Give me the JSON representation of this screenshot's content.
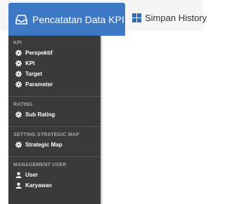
{
  "tabs": [
    {
      "label": "Pencatatan Data KPI",
      "icon": "inbox-tray-icon",
      "active": true
    },
    {
      "label": "Simpan History",
      "icon": "grid-icon",
      "active": false
    }
  ],
  "menu": {
    "sections": [
      {
        "header": "KPI",
        "items": [
          {
            "label": "Perspektif",
            "icon": "gear-icon"
          },
          {
            "label": "KPI",
            "icon": "gear-icon"
          },
          {
            "label": "Target",
            "icon": "gear-icon"
          },
          {
            "label": "Parameter",
            "icon": "gear-icon"
          }
        ]
      },
      {
        "header": "RATING",
        "items": [
          {
            "label": "Sub Rating",
            "icon": "gear-icon"
          }
        ]
      },
      {
        "header": "SETTING STRATEGIC MAP",
        "items": [
          {
            "label": "Strategic Map",
            "icon": "gear-icon"
          }
        ]
      },
      {
        "header": "MANAGEMENT USER",
        "items": [
          {
            "label": "User",
            "icon": "user-icon"
          },
          {
            "label": "Karyawan",
            "icon": "user-icon"
          }
        ]
      }
    ]
  },
  "colors": {
    "tab_active_bg": "#3c78c4",
    "menu_bg": "#3a3a3a",
    "section_header": "#a5a5a5"
  }
}
